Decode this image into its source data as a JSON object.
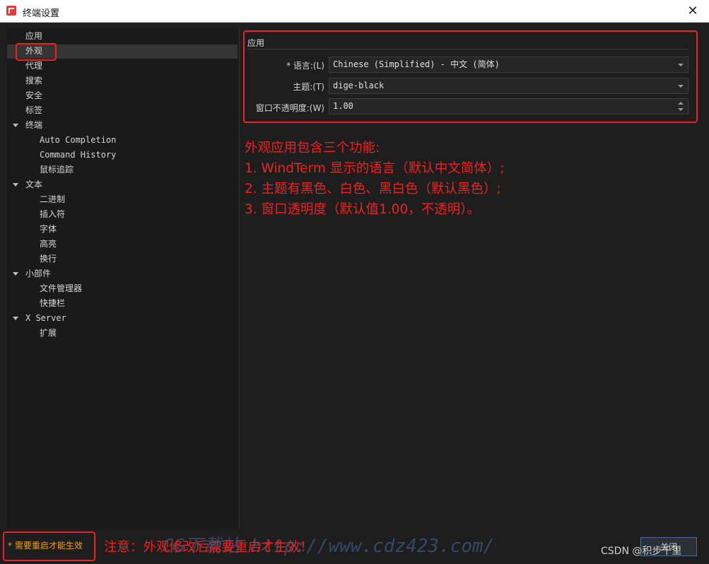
{
  "window": {
    "title": "终端设置",
    "close_glyph": "✕",
    "icon": "app-icon"
  },
  "sidebar": {
    "items": [
      {
        "label": "应用",
        "level": 0
      },
      {
        "label": "外观",
        "level": 0,
        "selected": true
      },
      {
        "label": "代理",
        "level": 0
      },
      {
        "label": "搜索",
        "level": 0
      },
      {
        "label": "安全",
        "level": 0
      },
      {
        "label": "标签",
        "level": 0
      },
      {
        "label": "终端",
        "level": 0,
        "expanded": true
      },
      {
        "label": "Auto Completion",
        "level": 1
      },
      {
        "label": "Command History",
        "level": 1
      },
      {
        "label": "鼠标追踪",
        "level": 1
      },
      {
        "label": "文本",
        "level": 0,
        "expanded": true
      },
      {
        "label": "二进制",
        "level": 1
      },
      {
        "label": "插入符",
        "level": 1
      },
      {
        "label": "字体",
        "level": 1
      },
      {
        "label": "高亮",
        "level": 1
      },
      {
        "label": "换行",
        "level": 1
      },
      {
        "label": "小部件",
        "level": 0,
        "expanded": true
      },
      {
        "label": "文件管理器",
        "level": 1
      },
      {
        "label": "快捷栏",
        "level": 1
      },
      {
        "label": "X Server",
        "level": 0,
        "expanded": true
      },
      {
        "label": "扩展",
        "level": 1
      }
    ]
  },
  "section": {
    "title": "应用",
    "language_label": "* 语言:(L)",
    "language_value": "Chinese (Simplified) - 中文 (简体)",
    "theme_label": "主题:(T)",
    "theme_value": "dige-black",
    "opacity_label": "窗口不透明度:(W)",
    "opacity_value": "1.00"
  },
  "annotation": {
    "lines": [
      "外观应用包含三个功能:",
      "1. WindTerm 显示的语言（默认中文简体）;",
      "2. 主题有黑色、白色、黑白色（默认黑色）;",
      "3. 窗口透明度（默认值1.00，不透明）。"
    ]
  },
  "footer": {
    "restart_note": "* 需要重启才能生效",
    "notice": "注意：外观修改后需要重启才生效！",
    "watermark": "CG下载站 http://www.cdz423.com/",
    "csdn": "CSDN @积步千里",
    "close_button": "关闭"
  },
  "colors": {
    "accent_red": "#ee2222",
    "note_orange": "#e8a030",
    "background": "#1e1e1e"
  }
}
